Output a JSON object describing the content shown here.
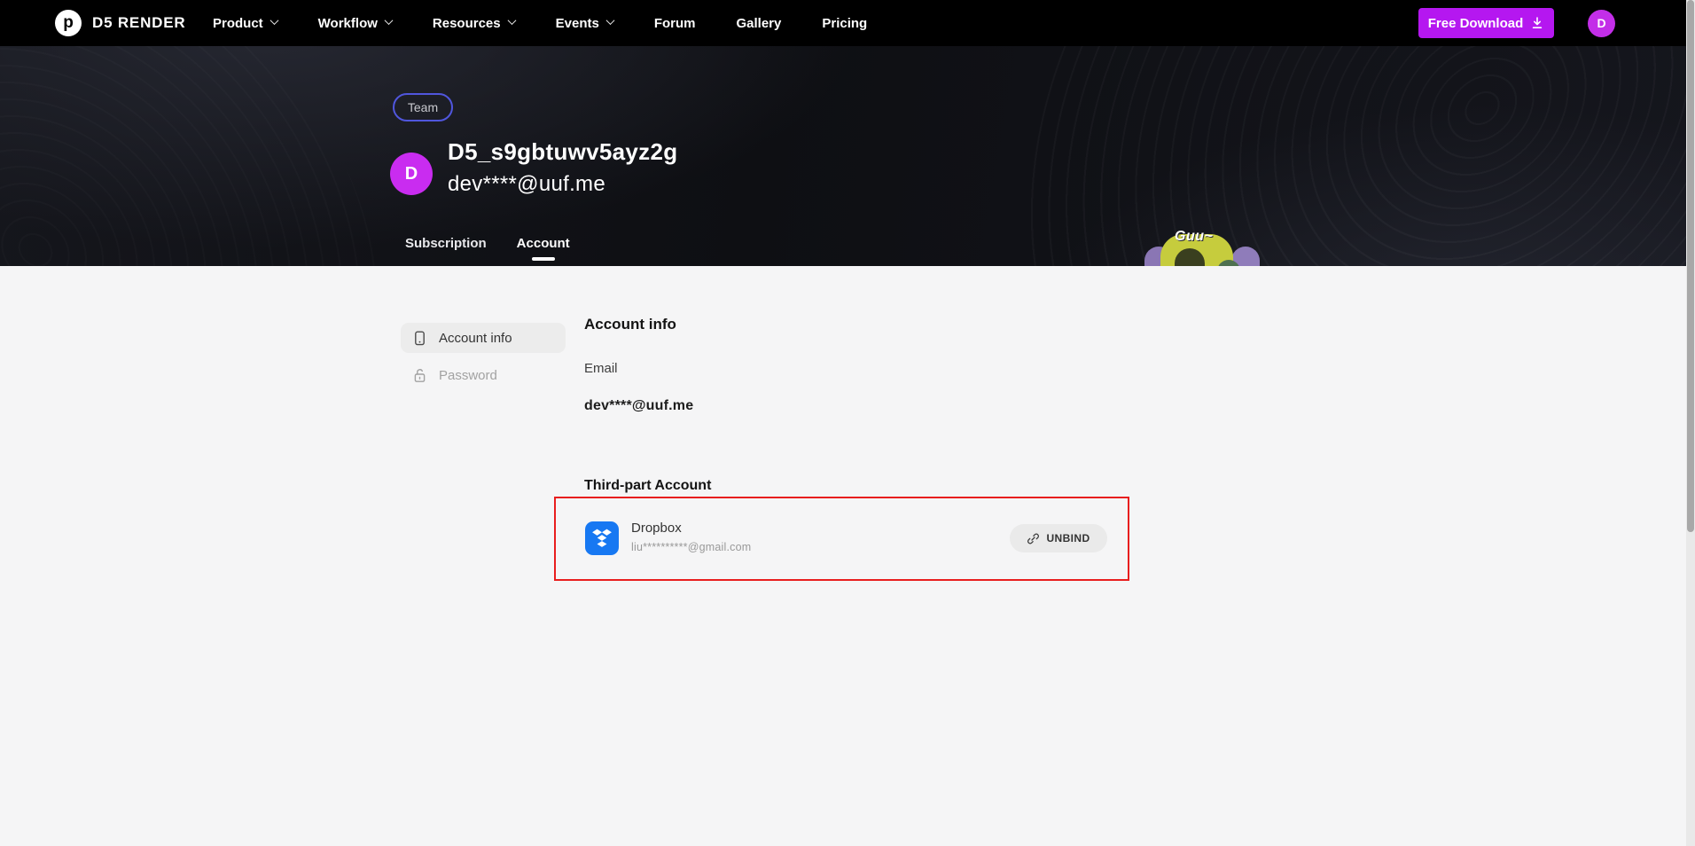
{
  "navbar": {
    "brand": "D5 RENDER",
    "items": [
      {
        "label": "Product",
        "has_dropdown": true
      },
      {
        "label": "Workflow",
        "has_dropdown": true
      },
      {
        "label": "Resources",
        "has_dropdown": true
      },
      {
        "label": "Events",
        "has_dropdown": true
      },
      {
        "label": "Forum",
        "has_dropdown": false
      },
      {
        "label": "Gallery",
        "has_dropdown": false
      },
      {
        "label": "Pricing",
        "has_dropdown": false
      }
    ],
    "download_label": "Free Download",
    "avatar_letter": "D"
  },
  "hero": {
    "team_badge": "Team",
    "avatar_letter": "D",
    "username": "D5_s9gbtuwv5ayz2g",
    "email": "dev****@uuf.me",
    "tabs": [
      {
        "label": "Subscription",
        "active": false
      },
      {
        "label": "Account",
        "active": true
      }
    ],
    "illustration_text": "Guu~"
  },
  "account": {
    "menu": [
      {
        "label": "Account info",
        "icon": "account-card-icon",
        "active": true
      },
      {
        "label": "Password",
        "icon": "unlock-icon",
        "active": false
      }
    ],
    "section_title": "Account info",
    "email_label": "Email",
    "email_value": "dev****@uuf.me",
    "third_party_title": "Third-part Account",
    "providers": [
      {
        "name": "Dropbox",
        "icon": "dropbox-icon",
        "account": "liu**********@gmail.com",
        "action_label": "UNBIND"
      }
    ]
  },
  "colors": {
    "accent_purple": "#b517f0",
    "avatar_magenta": "#c92cf0",
    "team_border": "#5056dd",
    "annotation_red": "#e81e1e",
    "dropbox_blue": "#1778f2",
    "navbar_bg": "#000000",
    "page_bg": "#f5f5f6"
  }
}
